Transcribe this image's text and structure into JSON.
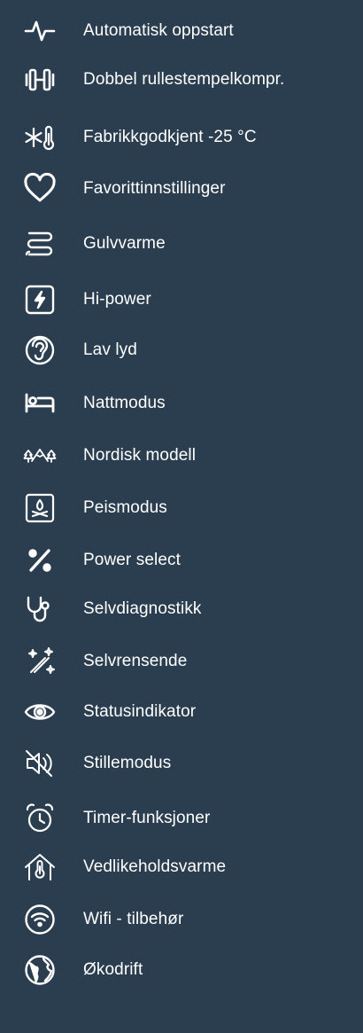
{
  "features": [
    {
      "label": "Automatisk oppstart",
      "icon": "pulse-icon"
    },
    {
      "label": "Dobbel rullestempelkompr.",
      "icon": "dumbbell-compressor-icon"
    },
    {
      "label": "Fabrikkgodkjent -25 °C",
      "icon": "snowflake-thermometer-icon"
    },
    {
      "label": "Favorittinnstillinger",
      "icon": "heart-icon"
    },
    {
      "label": "Gulvvarme",
      "icon": "floor-heating-icon"
    },
    {
      "label": "Hi-power",
      "icon": "lightning-icon"
    },
    {
      "label": "Lav lyd",
      "icon": "ear-icon"
    },
    {
      "label": "Nattmodus",
      "icon": "bed-icon"
    },
    {
      "label": "Nordisk modell",
      "icon": "mountains-trees-icon"
    },
    {
      "label": "Peismodus",
      "icon": "fireplace-icon"
    },
    {
      "label": "Power select",
      "icon": "percent-icon"
    },
    {
      "label": "Selvdiagnostikk",
      "icon": "stethoscope-icon"
    },
    {
      "label": "Selvrensende",
      "icon": "magic-wand-icon"
    },
    {
      "label": "Statusindikator",
      "icon": "eye-icon"
    },
    {
      "label": "Stillemodus",
      "icon": "speaker-muted-icon"
    },
    {
      "label": "Timer-funksjoner",
      "icon": "alarm-clock-icon"
    },
    {
      "label": "Vedlikeholdsvarme",
      "icon": "house-thermometer-icon"
    },
    {
      "label": "Wifi - tilbehør",
      "icon": "wifi-icon"
    },
    {
      "label": "Økodrift",
      "icon": "globe-icon"
    }
  ],
  "colors": {
    "background": "#2b3e50",
    "foreground": "#ffffff"
  }
}
